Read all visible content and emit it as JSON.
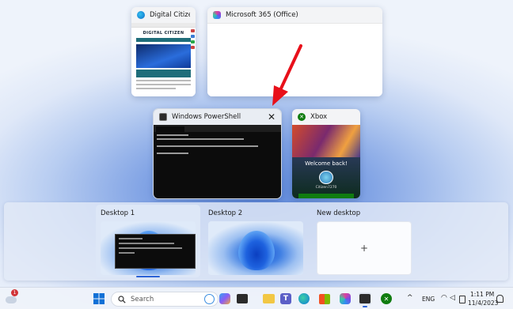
{
  "windows": {
    "digital_citizen": {
      "title": "Digital Citizen",
      "site_logo": "DIGITAL CITIZEN"
    },
    "m365": {
      "title": "Microsoft 365 (Office)"
    },
    "powershell": {
      "title": "Windows PowerShell",
      "close_glyph": "✕"
    },
    "xbox": {
      "title": "Xbox",
      "welcome": "Welcome back!",
      "gamertag": "Citizen7270"
    }
  },
  "desktops": [
    {
      "label": "Desktop 1",
      "active": true
    },
    {
      "label": "Desktop 2",
      "active": false
    },
    {
      "label": "New desktop",
      "add_glyph": "+"
    }
  ],
  "taskbar": {
    "search_placeholder": "Search",
    "weather_badge": "1",
    "tray_language": "ENG",
    "time": "1:11 PM",
    "date": "11/4/2023",
    "chevron": "^"
  },
  "colors": {
    "accent": "#2b62d6",
    "arrow": "#e8101a",
    "xbox_green": "#107c10"
  },
  "icons": [
    "weather-icon",
    "start-icon",
    "search-icon",
    "copilot-icon",
    "widgets-icon",
    "task-view-icon",
    "file-explorer-icon",
    "teams-icon",
    "edge-icon",
    "store-icon",
    "m365-icon",
    "terminal-icon",
    "xbox-icon",
    "wifi-icon",
    "volume-icon",
    "battery-icon",
    "bell-icon"
  ]
}
